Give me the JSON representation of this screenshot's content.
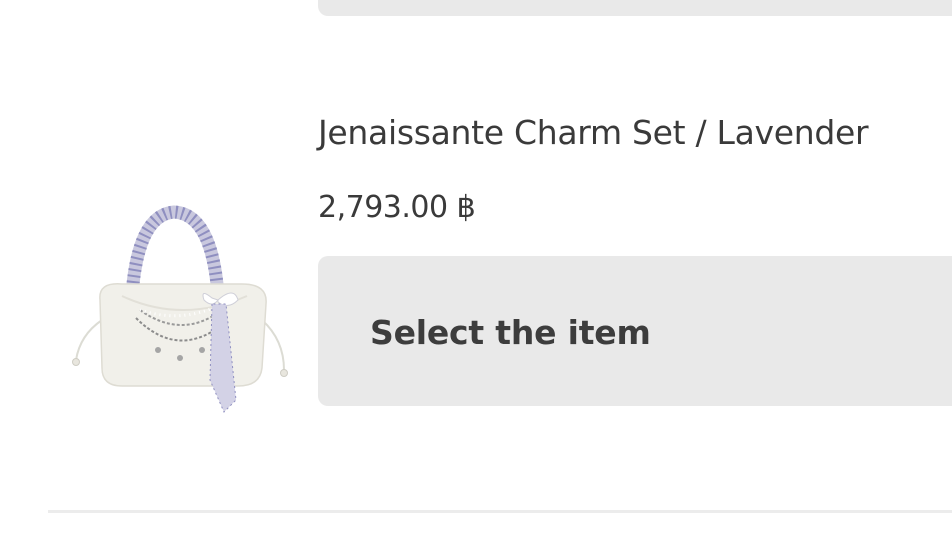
{
  "product": {
    "title": "Jenaissante Charm Set / Lavender",
    "price": "2,793.00 ฿",
    "image_icon": "handbag-with-scarf-and-charms"
  },
  "actions": {
    "select_label": "Select the item"
  },
  "colors": {
    "card_background": "#e9e9e9",
    "text": "#3a3a3a",
    "divider": "#ececec"
  }
}
